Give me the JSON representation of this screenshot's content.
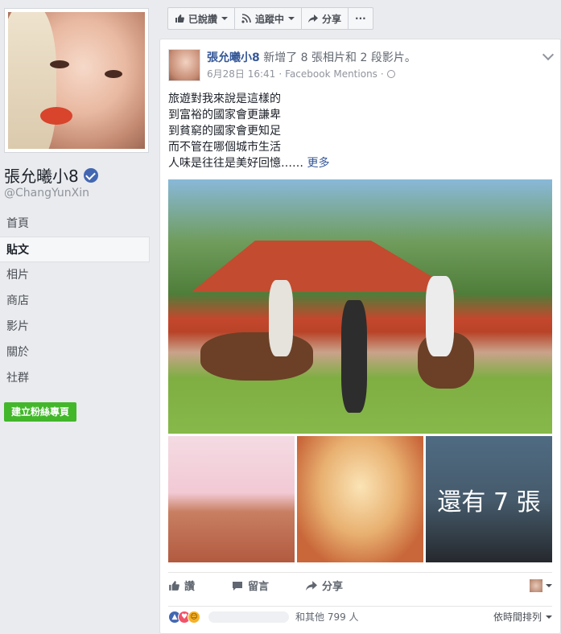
{
  "sidebar": {
    "page_name": "張允曦小8",
    "handle": "@ChangYunXin",
    "nav": [
      "首頁",
      "貼文",
      "相片",
      "商店",
      "影片",
      "關於",
      "社群"
    ],
    "active_index": 1,
    "create_page_label": "建立粉絲專頁"
  },
  "action_bar": {
    "liked": "已說讚",
    "following": "追蹤中",
    "share": "分享",
    "more": "···"
  },
  "post": {
    "author": "張允曦小8",
    "headline_rest": " 新增了 8 張相片和 2 段影片。",
    "date": "6月28日 16:41",
    "separator": " · ",
    "via": "Facebook Mentions",
    "separator2": " · ",
    "text_lines": [
      "旅遊對我來說是這樣的",
      "到富裕的國家會更謙卑",
      "到貧窮的國家會更知足",
      "而不管在哪個城市生活",
      "人味是往往是美好回憶……"
    ],
    "see_more": " 更多",
    "more_photos": "還有 7 張",
    "actions": {
      "like": "讚",
      "comment": "留言",
      "share": "分享"
    },
    "reactions": {
      "others": "和其他 799 人",
      "sort": "依時間排列"
    }
  },
  "colors": {
    "link": "#365899",
    "verified": "#4267b2",
    "create_button": "#42b72a",
    "background": "#e9ebee"
  }
}
